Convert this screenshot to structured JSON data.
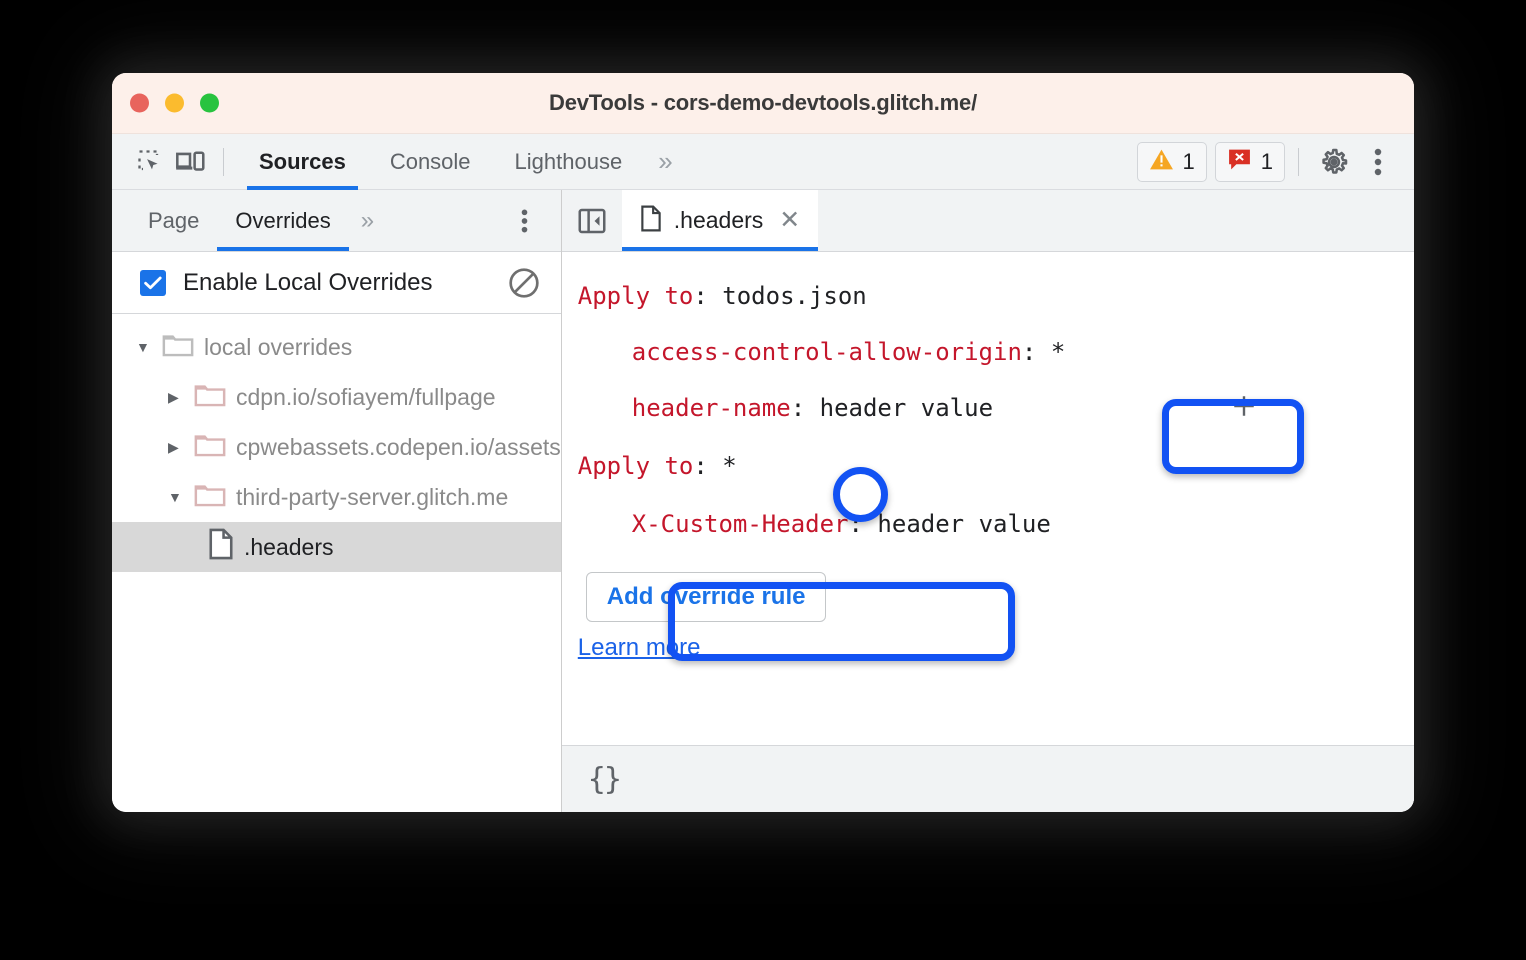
{
  "window": {
    "title": "DevTools - cors-demo-devtools.glitch.me/",
    "traffic_lights": [
      "close",
      "minimize",
      "maximize"
    ]
  },
  "devtools_toolbar": {
    "inspect_icon": "inspect-element-icon",
    "device_icon": "device-toolbar-icon",
    "tabs": [
      {
        "label": "Sources",
        "active": true
      },
      {
        "label": "Console",
        "active": false
      },
      {
        "label": "Lighthouse",
        "active": false
      }
    ],
    "more_tabs": "»",
    "warnings": {
      "icon": "warning-triangle-icon",
      "count": "1"
    },
    "errors": {
      "icon": "error-badge-icon",
      "count": "1"
    },
    "settings_icon": "gear-icon",
    "more_icon": "kebab-menu-icon"
  },
  "navigator": {
    "tabs": [
      {
        "label": "Page",
        "active": false
      },
      {
        "label": "Overrides",
        "active": true
      }
    ],
    "more_tabs": "»",
    "menu_icon": "kebab-menu-icon",
    "enable_overrides": {
      "label": "Enable Local Overrides",
      "checked": true,
      "clear_icon": "clear-configuration-icon"
    },
    "tree": [
      {
        "depth": 1,
        "label": "local overrides",
        "type": "folder",
        "expanded": true,
        "selected": false
      },
      {
        "depth": 2,
        "label": "cdpn.io/sofiayem/fullpage",
        "type": "folder",
        "expanded": false,
        "selected": false
      },
      {
        "depth": 2,
        "label": "cpwebassets.codepen.io/assets",
        "type": "folder",
        "expanded": false,
        "selected": false
      },
      {
        "depth": 2,
        "label": "third-party-server.glitch.me",
        "type": "folder",
        "expanded": true,
        "selected": false
      },
      {
        "depth": 3,
        "label": ".headers",
        "type": "file",
        "expanded": false,
        "selected": true
      }
    ]
  },
  "editor": {
    "sidebar_toggle_icon": "show-navigator-icon",
    "tab": {
      "file_icon": "file-icon",
      "name": ".headers",
      "close_icon": "close-icon"
    },
    "rules": [
      {
        "apply_label": "Apply to",
        "apply_value": "todos.json",
        "headers": [
          {
            "name": "access-control-allow-origin",
            "value": "*",
            "has_buttons": false
          },
          {
            "name": "header-name",
            "value": "header value",
            "has_buttons": true
          }
        ]
      },
      {
        "apply_label": "Apply to",
        "apply_value": "*",
        "headers": [
          {
            "name": "X-Custom-Header",
            "value": "header value",
            "has_buttons": false
          }
        ]
      }
    ],
    "row_buttons": {
      "add_icon": "plus-icon",
      "delete_icon": "trash-icon"
    },
    "add_rule_label": "Add override rule",
    "learn_more_label": "Learn more",
    "statusbar": {
      "pretty_print": "{}",
      "drawer_icon": "show-drawer-icon"
    }
  },
  "annotations": {
    "accent_color": "#1252f3",
    "highlights": [
      "row-add-delete-buttons",
      "apply-to-asterisk",
      "add-override-rule-button"
    ]
  },
  "colors": {
    "titlebar_bg": "#fdf0ea",
    "toolbar_bg": "#f1f3f4",
    "accent_blue": "#1a73e8",
    "header_name_red": "#c4162b",
    "selection_gray": "#d8d8d8",
    "warning_orange": "#f5a623",
    "error_red": "#d93025"
  }
}
